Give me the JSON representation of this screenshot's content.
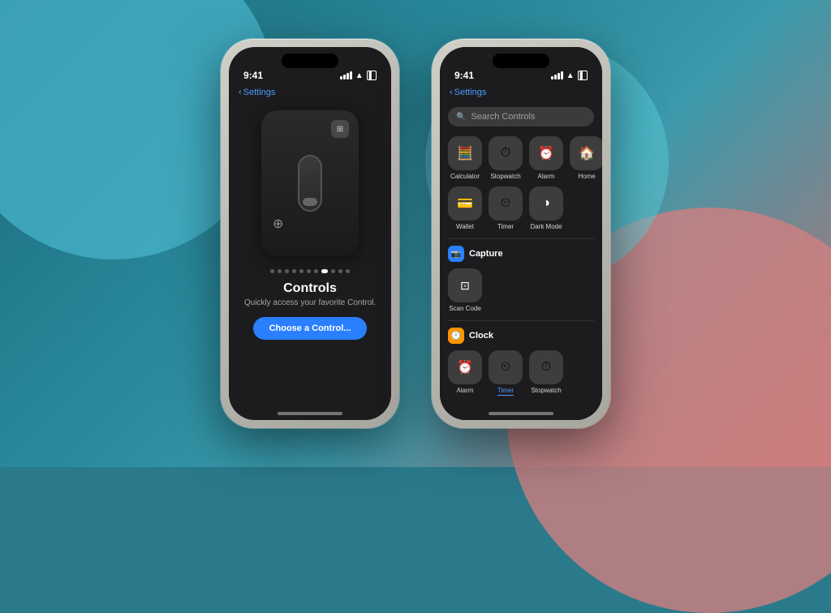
{
  "background": {
    "color1": "#1a6a7c",
    "color2": "#3a9aac",
    "color3": "#d08080"
  },
  "phone1": {
    "status_time": "9:41",
    "back_label": "Settings",
    "title": "Controls",
    "subtitle": "Quickly access your favorite Control.",
    "choose_button": "Choose a Control..."
  },
  "phone2": {
    "status_time": "9:41",
    "back_label": "Settings",
    "search_placeholder": "Search Controls",
    "controls_grid": [
      {
        "icon": "🧮",
        "label": "Calculator"
      },
      {
        "icon": "⏱",
        "label": "Stopwatch"
      },
      {
        "icon": "⏰",
        "label": "Alarm"
      },
      {
        "icon": "🏠",
        "label": "Home"
      },
      {
        "icon": "💳",
        "label": "Wallet"
      },
      {
        "icon": "⏲",
        "label": "Timer"
      },
      {
        "icon": "◑",
        "label": "Dark Mode"
      }
    ],
    "capture_section": {
      "label": "Capture",
      "icon": "📷",
      "items": [
        {
          "icon": "⊡",
          "label": "Scan Code"
        }
      ]
    },
    "clock_section": {
      "label": "Clock",
      "icon": "🕐",
      "items": [
        {
          "icon": "⏰",
          "label": "Alarm"
        },
        {
          "icon": "⏲",
          "label": "Timer",
          "active": true
        },
        {
          "icon": "⏱",
          "label": "Stopwatch"
        }
      ]
    }
  }
}
